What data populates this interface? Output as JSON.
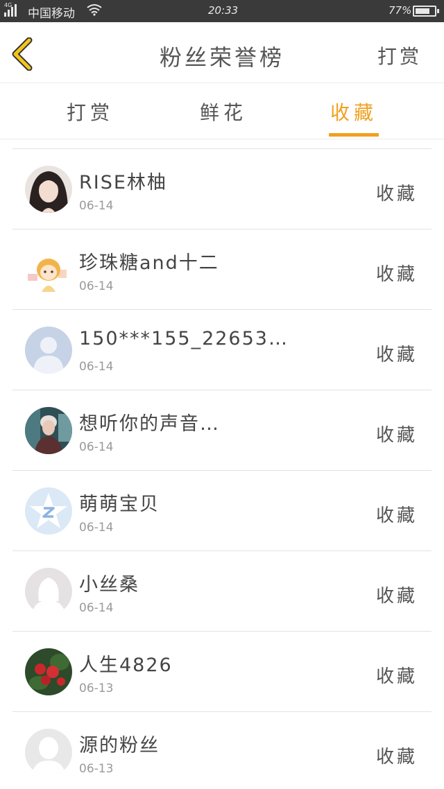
{
  "status_bar": {
    "network": "4G",
    "carrier": "中国移动",
    "time": "20:33",
    "battery_pct": "77%",
    "battery_level": 0.77
  },
  "nav": {
    "title": "粉丝荣誉榜",
    "right_action": "打赏"
  },
  "tabs": [
    {
      "label": "打赏",
      "active": false
    },
    {
      "label": "鲜花",
      "active": false
    },
    {
      "label": "收藏",
      "active": true
    }
  ],
  "accent_color": "#f0a020",
  "items": [
    {
      "name": "RISE林柚",
      "date": "06-14",
      "action": "收藏",
      "avatar": "girl-photo-avatar"
    },
    {
      "name": "珍珠糖and十二",
      "date": "06-14",
      "action": "收藏",
      "avatar": "cartoon-avatar"
    },
    {
      "name": "150***155_22653…",
      "date": "06-14",
      "action": "收藏",
      "avatar": "default-person-avatar"
    },
    {
      "name": "想听你的声音…",
      "date": "06-14",
      "action": "收藏",
      "avatar": "boy-photo-avatar"
    },
    {
      "name": "萌萌宝贝",
      "date": "06-14",
      "action": "收藏",
      "avatar": "qzone-star-avatar"
    },
    {
      "name": "小丝桑",
      "date": "06-14",
      "action": "收藏",
      "avatar": "female-silhouette-avatar"
    },
    {
      "name": "人生4826",
      "date": "06-13",
      "action": "收藏",
      "avatar": "flower-photo-avatar"
    },
    {
      "name": "源的粉丝",
      "date": "06-13",
      "action": "收藏",
      "avatar": "default-gray-avatar"
    }
  ]
}
